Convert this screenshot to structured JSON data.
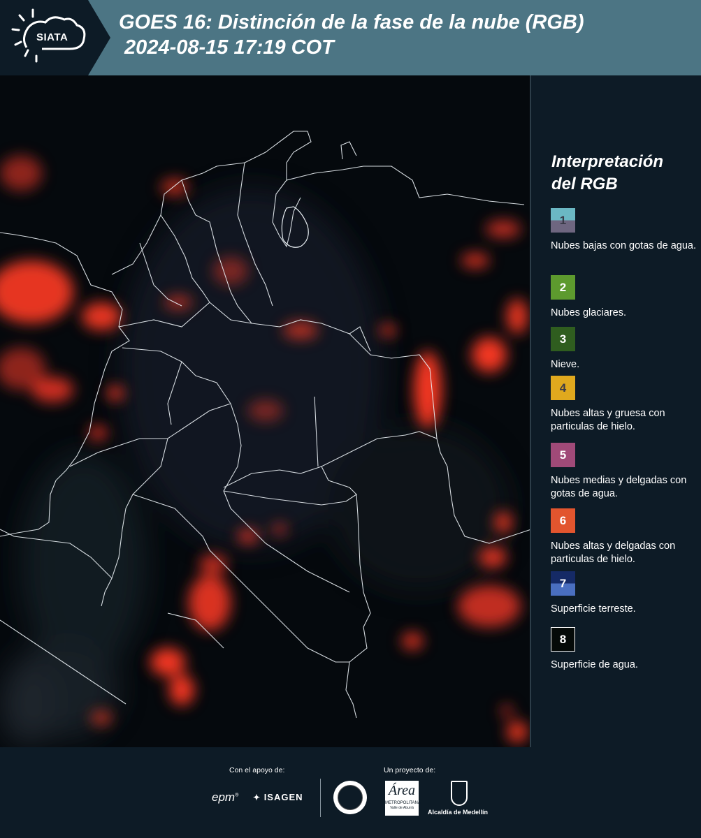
{
  "header": {
    "logo_text": "SIATA",
    "title_line1": "GOES 16: Distinción de la fase de la nube (RGB)",
    "title_line2": " 2024-08-15 17:19 COT"
  },
  "legend": {
    "title": "Interpretación del RGB",
    "items": [
      {
        "number": "1",
        "label": "Nubes bajas con gotas de agua.",
        "color_top": "#6bb8c4",
        "color_bottom": "#6e6680"
      },
      {
        "number": "2",
        "label": "Nubes glaciares.",
        "color_top": "#5d9a2e",
        "color_bottom": "#5d9a2e"
      },
      {
        "number": "3",
        "label": "Nieve.",
        "color_top": "#2f5d1f",
        "color_bottom": "#2f5d1f"
      },
      {
        "number": "4",
        "label": "Nubes altas y gruesa con particulas de hielo.",
        "color_top": "#e0a91e",
        "color_bottom": "#e0a91e"
      },
      {
        "number": "5",
        "label": "Nubes medias y delgadas con gotas de agua.",
        "color_top": "#a04a78",
        "color_bottom": "#a04a78"
      },
      {
        "number": "6",
        "label": "Nubes altas y delgadas con particulas de hielo.",
        "color_top": "#e2552e",
        "color_bottom": "#e2552e"
      },
      {
        "number": "7",
        "label": "Superficie terreste.",
        "color_top": "#152a66",
        "color_bottom": "#4a6fc0"
      },
      {
        "number": "8",
        "label": "Superficie de agua.",
        "color_top": "#050a08",
        "color_bottom": "#050a08"
      }
    ]
  },
  "footer": {
    "support_label": "Con el apoyo de:",
    "project_label": "Un proyecto de:",
    "epm": "epm",
    "isagen": "ISAGEN",
    "area_metro": "METROPOLITANA",
    "area_sub": "Valle de Aburrá",
    "alcaldia": "Alcaldía de Medellín"
  },
  "colors": {
    "header_bg": "#4c7584",
    "panel_bg": "#0d1b26",
    "cloud_ice": "#ff3a25"
  }
}
